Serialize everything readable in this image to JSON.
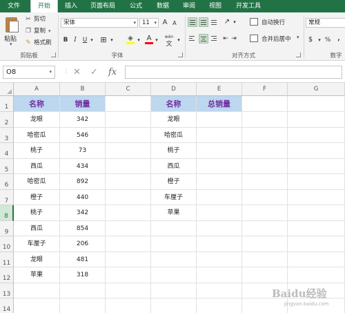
{
  "tabs": [
    {
      "label": "文件"
    },
    {
      "label": "开始"
    },
    {
      "label": "插入"
    },
    {
      "label": "页面布局"
    },
    {
      "label": "公式"
    },
    {
      "label": "数据"
    },
    {
      "label": "审阅"
    },
    {
      "label": "视图"
    },
    {
      "label": "开发工具"
    }
  ],
  "active_tab": "开始",
  "colors": {
    "ribbon_green": "#217346",
    "header_fill": "#bdd7ee",
    "header_text": "#7030a0",
    "selected_row_header": "#d2e8d6"
  },
  "ribbon": {
    "clipboard": {
      "paste_label": "粘贴",
      "cut_label": "剪切",
      "copy_label": "复制",
      "format_painter_label": "格式刷",
      "group_label": "剪贴板"
    },
    "font": {
      "font_name": "宋体",
      "font_size": "11",
      "grow_label": "A",
      "shrink_label": "A",
      "bold_label": "B",
      "italic_label": "I",
      "underline_label": "U",
      "wen_label": "wén",
      "group_label": "字体"
    },
    "alignment": {
      "wrap_text_label": "自动换行",
      "merge_center_label": "合并后居中",
      "group_label": "对齐方式"
    },
    "number": {
      "format_value": "常规",
      "percent_label": "%",
      "comma_label": ",",
      "group_label": "数字"
    }
  },
  "formula_bar": {
    "name_box": "O8",
    "cancel_symbol": "✕",
    "enter_symbol": "✓",
    "fx_symbol": "fx",
    "formula": ""
  },
  "sheet": {
    "columns": [
      "A",
      "B",
      "C",
      "D",
      "E",
      "F",
      "G"
    ],
    "rows": [
      "1",
      "2",
      "3",
      "4",
      "5",
      "6",
      "7",
      "8",
      "9",
      "10",
      "11",
      "12",
      "13",
      "14"
    ],
    "selected_row": "8",
    "table1": {
      "headers": [
        "名称",
        "销量"
      ],
      "rows": [
        [
          "龙眼",
          "342"
        ],
        [
          "哈密瓜",
          "546"
        ],
        [
          "桃子",
          "73"
        ],
        [
          "西瓜",
          "434"
        ],
        [
          "哈密瓜",
          "892"
        ],
        [
          "橙子",
          "440"
        ],
        [
          "桃子",
          "342"
        ],
        [
          "西瓜",
          "854"
        ],
        [
          "车厘子",
          "206"
        ],
        [
          "龙眼",
          "481"
        ],
        [
          "苹果",
          "318"
        ]
      ]
    },
    "table2": {
      "headers": [
        "名称",
        "总销量"
      ],
      "rows": [
        [
          "龙眼"
        ],
        [
          "哈密瓜"
        ],
        [
          "桃子"
        ],
        [
          "西瓜"
        ],
        [
          "橙子"
        ],
        [
          "车厘子"
        ],
        [
          "苹果"
        ]
      ]
    }
  },
  "watermark": {
    "main": "Baidu经验",
    "sub": "jingyan.baidu.com"
  }
}
